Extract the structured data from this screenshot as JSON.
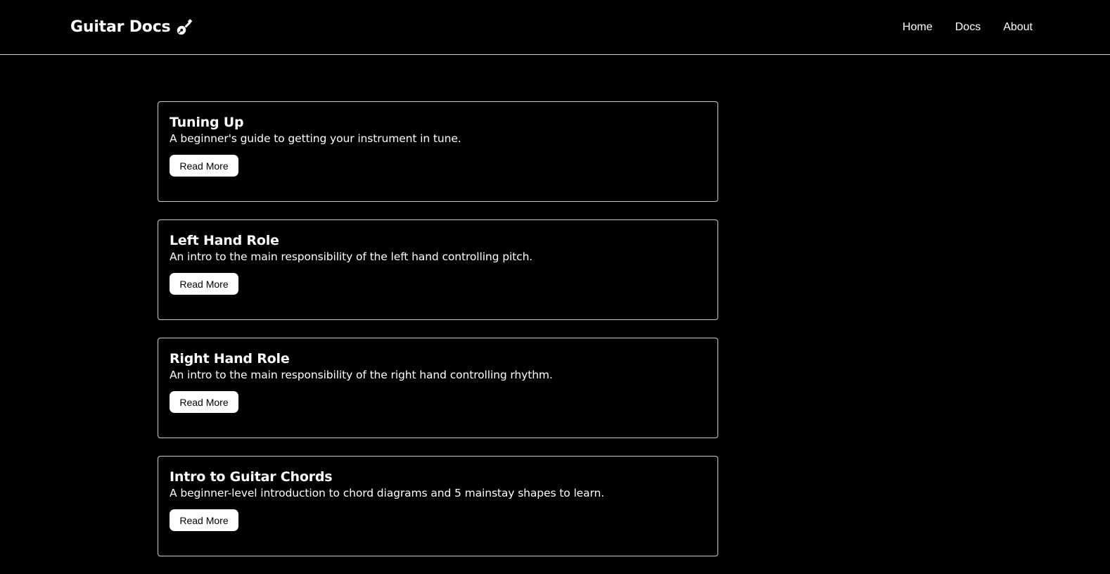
{
  "navbar": {
    "brand": "Guitar Docs",
    "brand_icon": "guitar-icon",
    "links": [
      "Home",
      "Docs",
      "About"
    ]
  },
  "cards": [
    {
      "title": "Tuning Up",
      "description": "A beginner's guide to getting your instrument in tune.",
      "button": "Read More"
    },
    {
      "title": "Left Hand Role",
      "description": "An intro to the main responsibility of the left hand controlling pitch.",
      "button": "Read More"
    },
    {
      "title": "Right Hand Role",
      "description": "An intro to the main responsibility of the right hand controlling rhythm.",
      "button": "Read More"
    },
    {
      "title": "Intro to Guitar Chords",
      "description": "A beginner-level introduction to chord diagrams and 5 mainstay shapes to learn.",
      "button": "Read More"
    }
  ],
  "colors": {
    "background": "#000000",
    "text": "#ffffff",
    "border": "#cfcfcf",
    "button_bg": "#ffffff",
    "button_text": "#000000"
  }
}
